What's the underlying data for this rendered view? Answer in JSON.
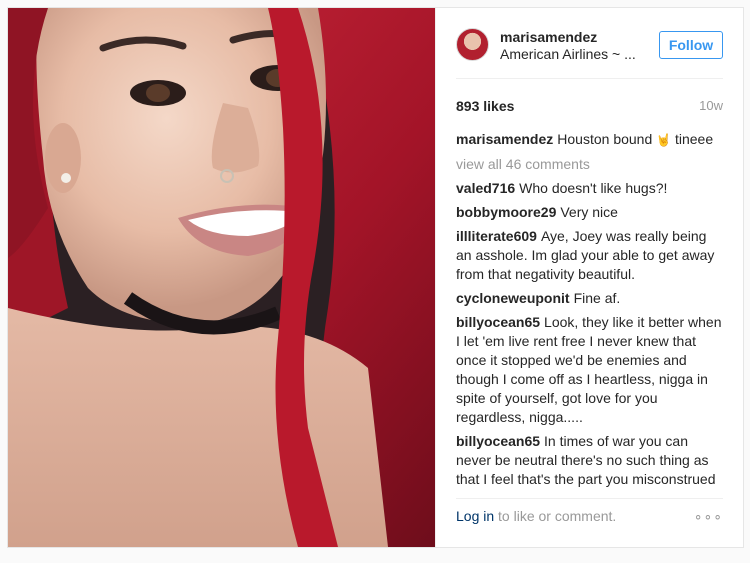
{
  "post": {
    "username": "marisamendez",
    "location": "American Airlines ~ ...",
    "follow_label": "Follow",
    "likes": "893 likes",
    "time_ago": "10w",
    "caption": {
      "user": "marisamendez",
      "text": "Houston bound",
      "emoji": "🤘",
      "text_after": "tineee"
    },
    "view_all": "view all 46 comments",
    "comments": [
      {
        "user": "valed716",
        "text": "Who doesn't like hugs?!"
      },
      {
        "user": "bobbymoore29",
        "text": "Very nice"
      },
      {
        "user": "illliterate609",
        "text": "Aye, Joey was really being an asshole. Im glad your able to get away from that negativity beautiful."
      },
      {
        "user": "cycloneweuponit",
        "text": "Fine af."
      },
      {
        "user": "billyocean65",
        "text": "Look, they like it better when I let 'em live rent free I never knew that once it stopped we'd be enemies and though I come off as I heartless, nigga in spite of yourself, got love for you regardless, nigga....."
      },
      {
        "user": "billyocean65",
        "text": "In times of war you can never be neutral there's no such thing as that I feel that's the part you misconstrued I bet that shit hurt to get that text but I bet it hurt more to see someone you've looked out for"
      }
    ],
    "footer": {
      "login_label": "Log in",
      "rest": " to like or comment.",
      "more": "∘∘∘"
    }
  },
  "colors": {
    "accent": "#3897f0",
    "muted": "#999999",
    "link": "#003569",
    "hair": "#b1202f"
  },
  "icons": {
    "more": "more-options-icon",
    "avatar": "avatar"
  }
}
